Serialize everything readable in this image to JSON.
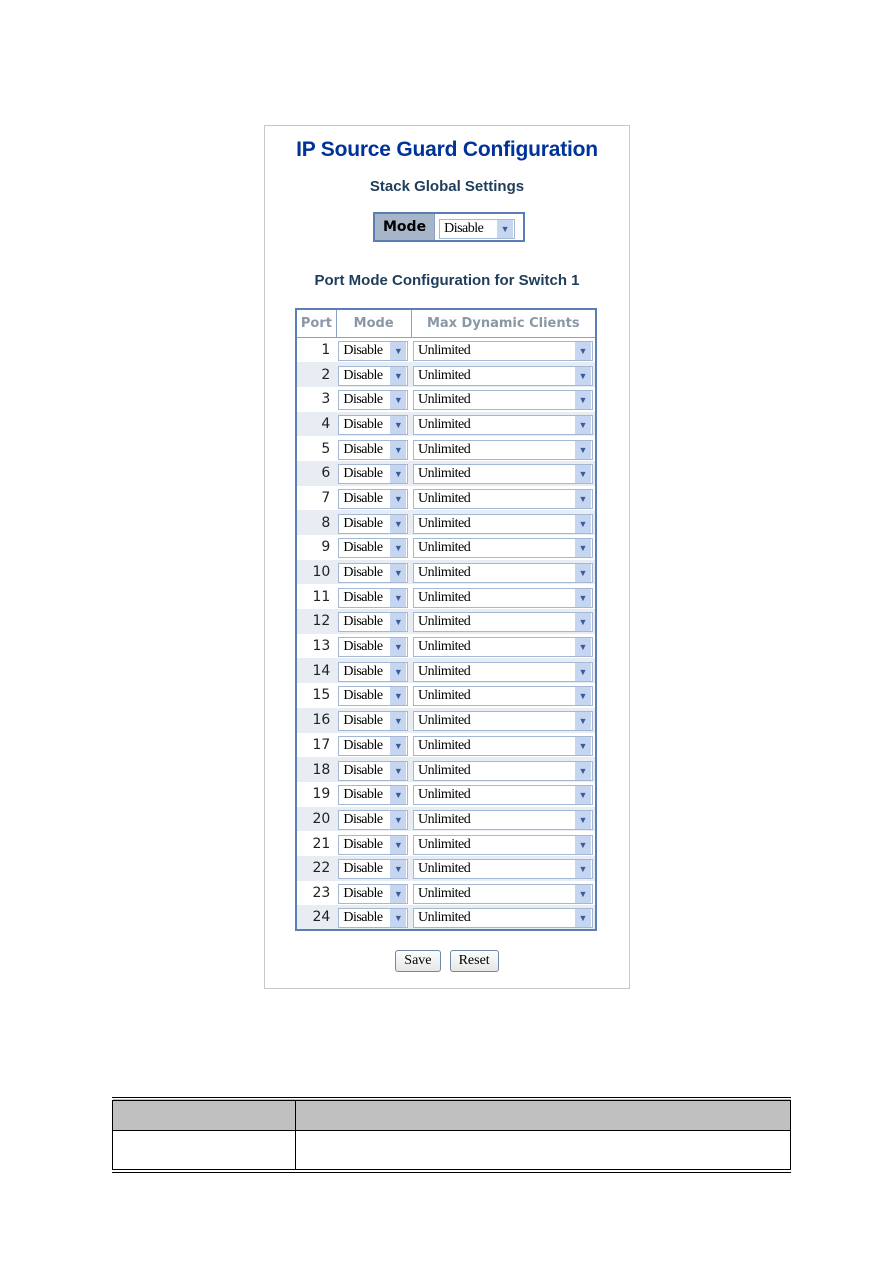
{
  "page": {
    "title": "IP Source Guard Configuration",
    "global_section": "Stack Global Settings",
    "global_mode": {
      "label": "Mode",
      "value": "Disable"
    },
    "port_section": "Port Mode Configuration for Switch 1",
    "table": {
      "headers": [
        "Port",
        "Mode",
        "Max Dynamic Clients"
      ],
      "rows": [
        {
          "port": "1",
          "mode": "Disable",
          "max": "Unlimited"
        },
        {
          "port": "2",
          "mode": "Disable",
          "max": "Unlimited"
        },
        {
          "port": "3",
          "mode": "Disable",
          "max": "Unlimited"
        },
        {
          "port": "4",
          "mode": "Disable",
          "max": "Unlimited"
        },
        {
          "port": "5",
          "mode": "Disable",
          "max": "Unlimited"
        },
        {
          "port": "6",
          "mode": "Disable",
          "max": "Unlimited"
        },
        {
          "port": "7",
          "mode": "Disable",
          "max": "Unlimited"
        },
        {
          "port": "8",
          "mode": "Disable",
          "max": "Unlimited"
        },
        {
          "port": "9",
          "mode": "Disable",
          "max": "Unlimited"
        },
        {
          "port": "10",
          "mode": "Disable",
          "max": "Unlimited"
        },
        {
          "port": "11",
          "mode": "Disable",
          "max": "Unlimited"
        },
        {
          "port": "12",
          "mode": "Disable",
          "max": "Unlimited"
        },
        {
          "port": "13",
          "mode": "Disable",
          "max": "Unlimited"
        },
        {
          "port": "14",
          "mode": "Disable",
          "max": "Unlimited"
        },
        {
          "port": "15",
          "mode": "Disable",
          "max": "Unlimited"
        },
        {
          "port": "16",
          "mode": "Disable",
          "max": "Unlimited"
        },
        {
          "port": "17",
          "mode": "Disable",
          "max": "Unlimited"
        },
        {
          "port": "18",
          "mode": "Disable",
          "max": "Unlimited"
        },
        {
          "port": "19",
          "mode": "Disable",
          "max": "Unlimited"
        },
        {
          "port": "20",
          "mode": "Disable",
          "max": "Unlimited"
        },
        {
          "port": "21",
          "mode": "Disable",
          "max": "Unlimited"
        },
        {
          "port": "22",
          "mode": "Disable",
          "max": "Unlimited"
        },
        {
          "port": "23",
          "mode": "Disable",
          "max": "Unlimited"
        },
        {
          "port": "24",
          "mode": "Disable",
          "max": "Unlimited"
        }
      ]
    },
    "buttons": {
      "save": "Save",
      "reset": "Reset"
    }
  },
  "colors": {
    "title": "#003399",
    "border": "#5b7fb5",
    "row_alt": "#e8edf3",
    "arrow_bg": "#c7d6f0"
  },
  "icons": {
    "dropdown": "chevron-down-icon"
  }
}
